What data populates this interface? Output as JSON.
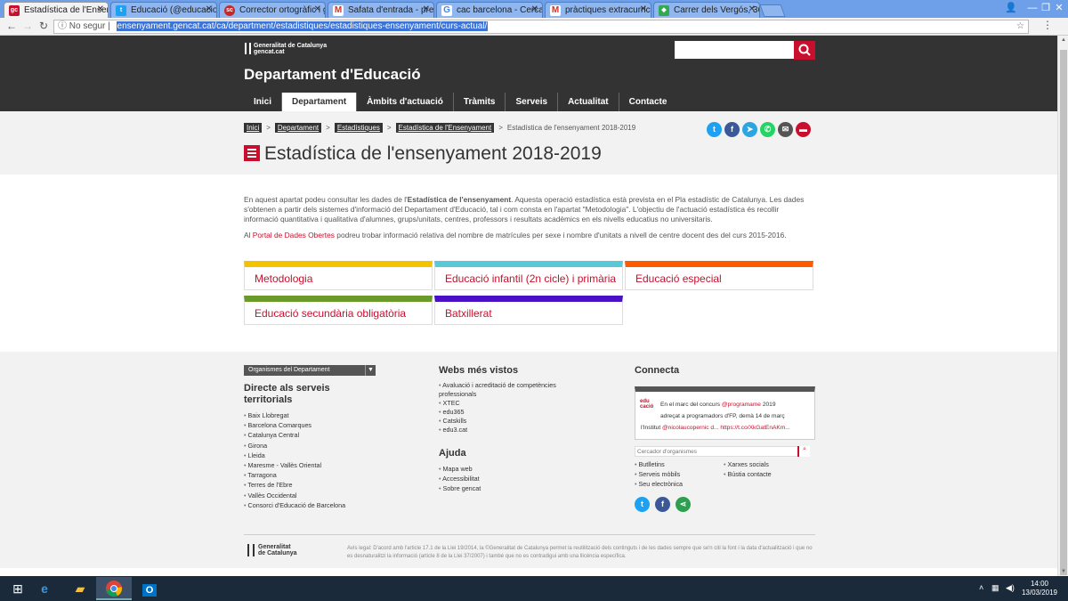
{
  "browser": {
    "tabs": [
      {
        "title": "Estadística de l'Ensenyam",
        "favicon": "gencat",
        "color": "#c8102e",
        "active": true
      },
      {
        "title": "Educació (@educaciocat",
        "favicon": "twitter",
        "color": "#1da1f2"
      },
      {
        "title": "Corrector ortogràfic i gra",
        "favicon": "softcatala",
        "color": "#c62828"
      },
      {
        "title": "Safata d'entrada - prems",
        "favicon": "gmail",
        "color": "#d93025"
      },
      {
        "title": "cac barcelona - Cerca am",
        "favicon": "google",
        "color": "#4285f4"
      },
      {
        "title": "pràctiques extracurricula",
        "favicon": "gmail",
        "color": "#d93025"
      },
      {
        "title": "Carrer dels Vergós, 36, G",
        "favicon": "maps",
        "color": "#34a853"
      }
    ],
    "security_label": "No segur",
    "url": "ensenyament.gencat.cat/ca/department/estadistiques/estadistiques-ensenyament/curs-actual/"
  },
  "site": {
    "logo_line1": "Generalitat de Catalunya",
    "logo_line2": "gencat.cat",
    "title": "Departament d'Educació",
    "nav": [
      "Inici",
      "Departament",
      "Àmbits d'actuació",
      "Tràmits",
      "Serveis",
      "Actualitat",
      "Contacte"
    ],
    "nav_active": 1
  },
  "breadcrumb": [
    "Inici",
    "Departament",
    "Estadístiques",
    "Estadística de l'Ensenyament"
  ],
  "breadcrumb_current": "Estadística de l'ensenyament 2018-2019",
  "share_icons": [
    {
      "name": "twitter-icon",
      "glyph": "t",
      "color": "#1da1f2"
    },
    {
      "name": "facebook-icon",
      "glyph": "f",
      "color": "#3b5998"
    },
    {
      "name": "telegram-icon",
      "glyph": "➤",
      "color": "#2ca5e0"
    },
    {
      "name": "whatsapp-icon",
      "glyph": "✆",
      "color": "#25d366"
    },
    {
      "name": "email-icon",
      "glyph": "✉",
      "color": "#555555"
    },
    {
      "name": "print-icon",
      "glyph": "▬",
      "color": "#c8102e"
    }
  ],
  "page_title": "Estadística de l'ensenyament 2018-2019",
  "intro": {
    "p1_a": "En aquest apartat podeu consultar les dades de l'",
    "p1_b": "Estadística de l'ensenyament",
    "p1_c": ". Aquesta operació estadística està prevista en el Pla estadístic de Catalunya. Les dades s'obtenen a partir dels sistemes d'informació del Departament d'Educació, tal i com consta en l'apartat \"Metodologia\". L'objectiu de l'actuació estadística és recollir informació quantitativa i qualitativa d'alumnes, grups/unitats, centres, professors i resultats acadèmics en els nivells educatius no universitaris.",
    "p2_a": "Al ",
    "p2_link": "Portal de Dades Obertes",
    "p2_b": " podreu trobar informació relativa del nombre de matrícules per sexe i nombre d'unitats a nivell de centre docent des del curs 2015-2016."
  },
  "cards": [
    {
      "label": "Metodologia",
      "color": "#f5c200"
    },
    {
      "label": "Educació infantil (2n cicle) i primària",
      "color": "#5bc8d8"
    },
    {
      "label": "Educació especial",
      "color": "#ff5a00"
    },
    {
      "label": "Educació secundària obligatòria",
      "color": "#6a9a2a"
    },
    {
      "label": "Batxillerat",
      "color": "#4a10c8"
    }
  ],
  "footer": {
    "org_select": "Organismes del Departament",
    "direct_title": "Directe als serveis territorials",
    "direct_items": [
      "Baix Llobregat",
      "Barcelona Comarques",
      "Catalunya Central",
      "Girona",
      "Lleida",
      "Maresme - Vallès Oriental",
      "Tarragona",
      "Terres de l'Ebre",
      "Vallès Occidental",
      "Consorci d'Educació de Barcelona"
    ],
    "webs_title": "Webs més vistos",
    "webs_items": [
      "Avaluació i acreditació de competències professionals",
      "XTEC",
      "edu365",
      "Catskills",
      "edu3.cat"
    ],
    "ajuda_title": "Ajuda",
    "ajuda_items": [
      "Mapa web",
      "Accessibilitat",
      "Sobre gencat"
    ],
    "connecta_title": "Connecta",
    "tweet_avatar": "edu cació",
    "tweet_l1": "En el marc del concurs ",
    "tweet_mention": "@programame",
    "tweet_l1b": " 2019",
    "tweet_l2": "adreçat a programadors d'FP, demà 14 de març",
    "tweet_l3": "l'Institut ",
    "tweet_mention2": "@nicolaucopernic d...",
    "tweet_link": "https://t.co/XkGatEnAKm...",
    "cercador_placeholder": "Cercador d'organismes",
    "links_col1": [
      "Butlletins",
      "Serveis mòbils",
      "Seu electrònica"
    ],
    "links_col2": [
      "Xarxes socials",
      "Bústia contacte"
    ],
    "social": [
      {
        "name": "twitter-icon",
        "glyph": "t",
        "color": "#1da1f2"
      },
      {
        "name": "facebook-icon",
        "glyph": "f",
        "color": "#3b5998"
      },
      {
        "name": "share-icon",
        "glyph": "⋖",
        "color": "#2e9e4f"
      }
    ],
    "logo_line1": "Generalitat",
    "logo_line2": "de Catalunya",
    "legal": "Avís legal: D'acord amb l'article 17.1 de la Llei 19/2014, la ©Generalitat de Catalunya permet la reutilització dels continguts i de les dades sempre que se'n citi la font i la data d'actualització i que no es desnaturalitzi la informació (article 8 de la Llei 37/2007) i també que no es contradigui amb una llicència específica."
  },
  "taskbar": {
    "time": "14:00",
    "date": "13/03/2019"
  }
}
